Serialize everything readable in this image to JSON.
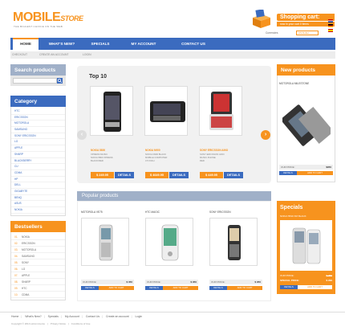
{
  "header": {
    "logo_main": "MOBILE",
    "logo_store": "STORE",
    "tagline": "THE BIGGEST CHOICE ON THE WEB",
    "cart_title": "Shopping cart:",
    "cart_sub": "now in your cart 0 items",
    "currency_label": "Currencies",
    "currency_value": "US Dollar"
  },
  "nav": {
    "items": [
      "HOME",
      "WHAT'S NEW?",
      "SPECIALS",
      "MY ACCOUNT",
      "CONTACT US"
    ]
  },
  "subnav": {
    "items": [
      "CHECKOUT",
      "CREATE AN ACCOUNT",
      "LOGIN"
    ]
  },
  "search": {
    "title": "Search products"
  },
  "category": {
    "title": "Category",
    "items": [
      "HTC",
      "ERICSSON",
      "MOTOROLA",
      "SAMSUNG",
      "SONY ERICSSON",
      "LG",
      "APPLE",
      "SHARP",
      "BLACKBERRY",
      "CU",
      "CDMA",
      "HP",
      "DELL",
      "GIGABYTE",
      "BENQ",
      "ASUS",
      "NOKIA",
      "PALM",
      "SANYO"
    ]
  },
  "bestsellers": {
    "title": "Bestsellers",
    "items": [
      {
        "n": "01.",
        "label": "NOKIA"
      },
      {
        "n": "02.",
        "label": "ERICSSON"
      },
      {
        "n": "03.",
        "label": "MOTOROLA"
      },
      {
        "n": "04.",
        "label": "SAMSUNG"
      },
      {
        "n": "05.",
        "label": "SONY"
      },
      {
        "n": "06.",
        "label": "LG"
      },
      {
        "n": "07.",
        "label": "APPLE"
      },
      {
        "n": "08.",
        "label": "SHARP"
      },
      {
        "n": "09.",
        "label": "HTC"
      },
      {
        "n": "10.",
        "label": "CDMA"
      }
    ]
  },
  "top10": {
    "title": "Top 10",
    "products": [
      {
        "name": "NOKIA 5800",
        "desc1": "XPRESS MUSIC",
        "desc2": "NOKIA 5800 XPRESS",
        "desc3": "BLACK/RED",
        "price": "$ 249.95",
        "details": "DETAILS"
      },
      {
        "name": "NOKIA N900",
        "desc1": "NOKIA N900 BLACK",
        "desc2": "MOBILE COMPUTER",
        "desc3": "3.5 INCH",
        "price": "$ 4649.95",
        "details": "DETAILS"
      },
      {
        "name": "SONY ERICSSON AINO",
        "desc1": "SONY ERICSSON AINO",
        "desc2": "MUSIC PHONE",
        "desc3": "RED",
        "price": "$ 449.95",
        "details": "DETAILS"
      }
    ]
  },
  "popular": {
    "title": "Popular products",
    "products": [
      {
        "name": "MOTOROLA VE75",
        "price_label": "OUR PRICE:",
        "price": "$ 350",
        "details": "DETAILS",
        "add": "ADD TO CART"
      },
      {
        "name": "HTC MAGIC",
        "price_label": "OUR PRICE:",
        "price": "$ 950",
        "details": "DETAILS",
        "add": "ADD TO CART"
      },
      {
        "name": "SONY ERICSSON",
        "price_label": "OUR PRICE:",
        "price": "$ 950",
        "details": "DETAILS",
        "add": "ADD TO CART"
      }
    ]
  },
  "new_products": {
    "title": "New products",
    "item_name": "MOTOROLA MILESTONE",
    "price_label": "OUR PRICE:",
    "price": "$950",
    "details": "DETAILS",
    "add": "ADD TO CART"
  },
  "specials": {
    "title": "Specials",
    "item_name": "NOKIA 5530 XM BLACK",
    "old_label": "OUR PRICE:",
    "old_price": "$ 350",
    "new_label": "SPECIAL PRICE:",
    "new_price": "$ 299",
    "details": "DETAILS",
    "add": "ADD TO CART"
  },
  "footer": {
    "links": [
      "Home",
      "What's New?",
      "Specials",
      "My Account",
      "Contact Us",
      "Create an account",
      "Login"
    ],
    "copy": "Copyright © 2010 osCommerce",
    "privacy": "Privacy Notice",
    "conditions": "Conditions of Use"
  },
  "colors": {
    "accent": "#f7931e",
    "nav_blue": "#3b6bbf",
    "panel_grey": "#f1f1f1"
  }
}
